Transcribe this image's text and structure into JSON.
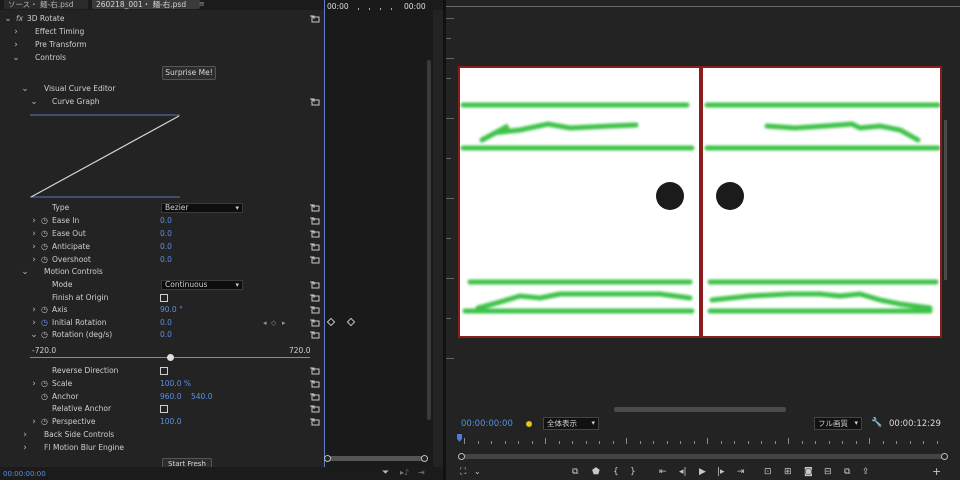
{
  "tabs": {
    "source": "ソース・ 麺-右.psd",
    "sequence": "260218_001・ 麺-右.psd",
    "menu_icon": "≡"
  },
  "effect_controls": {
    "rows": [
      {
        "label": "3D Rotate",
        "fx": "fx"
      },
      {
        "label": "Effect Timing"
      },
      {
        "label": "Pre Transform"
      },
      {
        "label": "Controls"
      },
      {
        "label": "Visual Curve Editor"
      },
      {
        "label": "Curve Graph"
      },
      {
        "label": "Type",
        "value": "Bezier"
      },
      {
        "label": "Ease In",
        "value": "0.0"
      },
      {
        "label": "Ease Out",
        "value": "0.0"
      },
      {
        "label": "Anticipate",
        "value": "0.0"
      },
      {
        "label": "Overshoot",
        "value": "0.0"
      },
      {
        "label": "Motion Controls"
      },
      {
        "label": "Mode",
        "value": "Continuous"
      },
      {
        "label": "Finish at Origin"
      },
      {
        "label": "Axis",
        "value": "90.0 °"
      },
      {
        "label": "Initial Rotation",
        "value": "0.0"
      },
      {
        "label": "Rotation (deg/s)",
        "value": "0.0"
      },
      {
        "label": "Reverse Direction"
      },
      {
        "label": "Scale",
        "value": "100.0 %"
      },
      {
        "label": "Anchor",
        "value": "960.0",
        "value2": "540.0"
      },
      {
        "label": "Relative Anchor"
      },
      {
        "label": "Perspective",
        "value": "100.0"
      },
      {
        "label": "Back Side Controls"
      },
      {
        "label": "Motion Blur Engine",
        "prefix": "FI"
      }
    ],
    "surprise_button": "Surprise Me!",
    "partial_button": "Start Fresh",
    "rotation_slider": {
      "min_label": "-720.0",
      "max_label": "720.0",
      "level": 0.5
    },
    "timeline": {
      "start": "00:00",
      "end": "00:00"
    },
    "footer_timecode": "00:00:00:00"
  },
  "program_monitor": {
    "timecode": "00:00:00:00",
    "zoom_label": "全体表示",
    "quality_label": "フル画質",
    "duration": "00:00:12:29",
    "accent": "#5b8fe0",
    "frame_border": "#8b1d1d",
    "stroke_color": "#3cc24a"
  }
}
